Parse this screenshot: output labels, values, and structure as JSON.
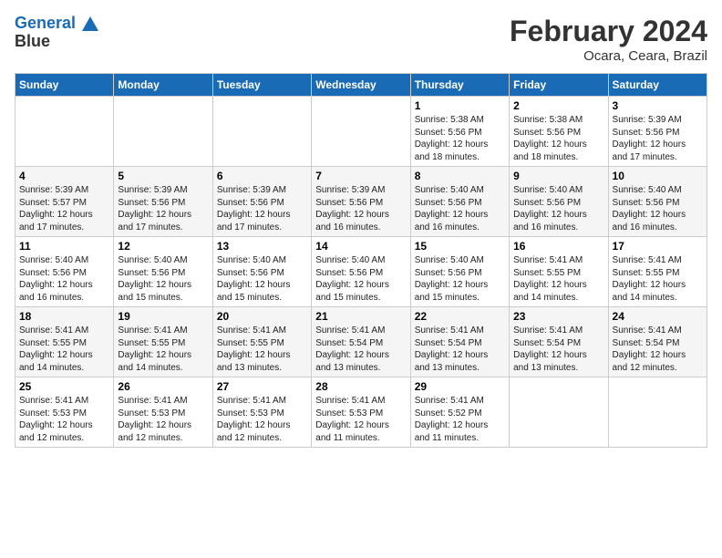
{
  "logo": {
    "line1": "General",
    "line2": "Blue"
  },
  "title": "February 2024",
  "location": "Ocara, Ceara, Brazil",
  "days_of_week": [
    "Sunday",
    "Monday",
    "Tuesday",
    "Wednesday",
    "Thursday",
    "Friday",
    "Saturday"
  ],
  "weeks": [
    [
      {
        "day": "",
        "info": ""
      },
      {
        "day": "",
        "info": ""
      },
      {
        "day": "",
        "info": ""
      },
      {
        "day": "",
        "info": ""
      },
      {
        "day": "1",
        "info": "Sunrise: 5:38 AM\nSunset: 5:56 PM\nDaylight: 12 hours\nand 18 minutes."
      },
      {
        "day": "2",
        "info": "Sunrise: 5:38 AM\nSunset: 5:56 PM\nDaylight: 12 hours\nand 18 minutes."
      },
      {
        "day": "3",
        "info": "Sunrise: 5:39 AM\nSunset: 5:56 PM\nDaylight: 12 hours\nand 17 minutes."
      }
    ],
    [
      {
        "day": "4",
        "info": "Sunrise: 5:39 AM\nSunset: 5:57 PM\nDaylight: 12 hours\nand 17 minutes."
      },
      {
        "day": "5",
        "info": "Sunrise: 5:39 AM\nSunset: 5:56 PM\nDaylight: 12 hours\nand 17 minutes."
      },
      {
        "day": "6",
        "info": "Sunrise: 5:39 AM\nSunset: 5:56 PM\nDaylight: 12 hours\nand 17 minutes."
      },
      {
        "day": "7",
        "info": "Sunrise: 5:39 AM\nSunset: 5:56 PM\nDaylight: 12 hours\nand 16 minutes."
      },
      {
        "day": "8",
        "info": "Sunrise: 5:40 AM\nSunset: 5:56 PM\nDaylight: 12 hours\nand 16 minutes."
      },
      {
        "day": "9",
        "info": "Sunrise: 5:40 AM\nSunset: 5:56 PM\nDaylight: 12 hours\nand 16 minutes."
      },
      {
        "day": "10",
        "info": "Sunrise: 5:40 AM\nSunset: 5:56 PM\nDaylight: 12 hours\nand 16 minutes."
      }
    ],
    [
      {
        "day": "11",
        "info": "Sunrise: 5:40 AM\nSunset: 5:56 PM\nDaylight: 12 hours\nand 16 minutes."
      },
      {
        "day": "12",
        "info": "Sunrise: 5:40 AM\nSunset: 5:56 PM\nDaylight: 12 hours\nand 15 minutes."
      },
      {
        "day": "13",
        "info": "Sunrise: 5:40 AM\nSunset: 5:56 PM\nDaylight: 12 hours\nand 15 minutes."
      },
      {
        "day": "14",
        "info": "Sunrise: 5:40 AM\nSunset: 5:56 PM\nDaylight: 12 hours\nand 15 minutes."
      },
      {
        "day": "15",
        "info": "Sunrise: 5:40 AM\nSunset: 5:56 PM\nDaylight: 12 hours\nand 15 minutes."
      },
      {
        "day": "16",
        "info": "Sunrise: 5:41 AM\nSunset: 5:55 PM\nDaylight: 12 hours\nand 14 minutes."
      },
      {
        "day": "17",
        "info": "Sunrise: 5:41 AM\nSunset: 5:55 PM\nDaylight: 12 hours\nand 14 minutes."
      }
    ],
    [
      {
        "day": "18",
        "info": "Sunrise: 5:41 AM\nSunset: 5:55 PM\nDaylight: 12 hours\nand 14 minutes."
      },
      {
        "day": "19",
        "info": "Sunrise: 5:41 AM\nSunset: 5:55 PM\nDaylight: 12 hours\nand 14 minutes."
      },
      {
        "day": "20",
        "info": "Sunrise: 5:41 AM\nSunset: 5:55 PM\nDaylight: 12 hours\nand 13 minutes."
      },
      {
        "day": "21",
        "info": "Sunrise: 5:41 AM\nSunset: 5:54 PM\nDaylight: 12 hours\nand 13 minutes."
      },
      {
        "day": "22",
        "info": "Sunrise: 5:41 AM\nSunset: 5:54 PM\nDaylight: 12 hours\nand 13 minutes."
      },
      {
        "day": "23",
        "info": "Sunrise: 5:41 AM\nSunset: 5:54 PM\nDaylight: 12 hours\nand 13 minutes."
      },
      {
        "day": "24",
        "info": "Sunrise: 5:41 AM\nSunset: 5:54 PM\nDaylight: 12 hours\nand 12 minutes."
      }
    ],
    [
      {
        "day": "25",
        "info": "Sunrise: 5:41 AM\nSunset: 5:53 PM\nDaylight: 12 hours\nand 12 minutes."
      },
      {
        "day": "26",
        "info": "Sunrise: 5:41 AM\nSunset: 5:53 PM\nDaylight: 12 hours\nand 12 minutes."
      },
      {
        "day": "27",
        "info": "Sunrise: 5:41 AM\nSunset: 5:53 PM\nDaylight: 12 hours\nand 12 minutes."
      },
      {
        "day": "28",
        "info": "Sunrise: 5:41 AM\nSunset: 5:53 PM\nDaylight: 12 hours\nand 11 minutes."
      },
      {
        "day": "29",
        "info": "Sunrise: 5:41 AM\nSunset: 5:52 PM\nDaylight: 12 hours\nand 11 minutes."
      },
      {
        "day": "",
        "info": ""
      },
      {
        "day": "",
        "info": ""
      }
    ]
  ]
}
